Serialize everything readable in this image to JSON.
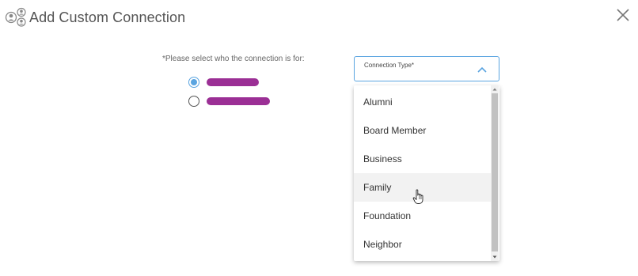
{
  "dialog": {
    "title": "Add Custom Connection",
    "header_icon": "people-icon",
    "close_icon": "close-icon"
  },
  "form": {
    "prompt": "*Please select who the connection is for:",
    "options": [
      {
        "label": "",
        "checked": true,
        "redacted": true
      },
      {
        "label": "",
        "checked": false,
        "redacted": true
      }
    ]
  },
  "connection_type": {
    "label": "Connection Type*",
    "value": "",
    "expanded": true,
    "options": [
      "Alumni",
      "Board Member",
      "Business",
      "Family",
      "Foundation",
      "Neighbor"
    ],
    "hovered": "Family"
  },
  "colors": {
    "accent": "#5aa4e0",
    "redaction": "#9b2f95",
    "hover_row": "#f2f2f2"
  }
}
